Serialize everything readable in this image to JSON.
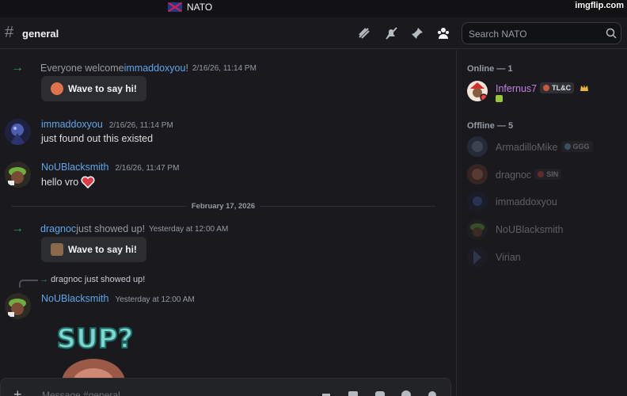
{
  "titlebar": {
    "server_name": "NATO",
    "watermark": "imgflip.com"
  },
  "header": {
    "channel": "general",
    "search_placeholder": "Search NATO"
  },
  "messages": [
    {
      "type": "system",
      "prefix": "Everyone welcome ",
      "user": "immaddoxyou",
      "suffix": "!",
      "time": "2/16/26, 11:14 PM",
      "button": "Wave to say hi!"
    },
    {
      "type": "message",
      "user": "immaddoxyou",
      "time": "2/16/26, 11:14 PM",
      "text": "just found out this existed"
    },
    {
      "type": "message",
      "user": "NoUBlacksmith",
      "time": "2/16/26, 11:47 PM",
      "text": "hello vro"
    },
    {
      "type": "system",
      "user": "dragnoc",
      "suffix": " just showed up!",
      "time": "Yesterday at 12:00 AM",
      "button": "Wave to say hi!"
    },
    {
      "type": "reply",
      "reply_user": "dragnoc",
      "reply_text": " just showed up!",
      "user": "NoUBlacksmith",
      "time": "Yesterday at 12:00 AM",
      "sticker_text": "SUP?"
    }
  ],
  "date_divider": "February 17, 2026",
  "composer": {
    "placeholder": "Message #general"
  },
  "members": {
    "online_header": "Online — 1",
    "offline_header": "Offline — 5",
    "online": [
      {
        "name": "Infernus7",
        "tag": "TL&C",
        "color": "#c67ee8"
      }
    ],
    "offline": [
      {
        "name": "ArmadilloMike",
        "tag": "GGG"
      },
      {
        "name": "dragnoc",
        "tag": "SIN"
      },
      {
        "name": "immaddoxyou",
        "tag": ""
      },
      {
        "name": "NoUBlacksmith",
        "tag": ""
      },
      {
        "name": "Virian",
        "tag": ""
      }
    ]
  },
  "colors": {
    "accent_link": "#5ea6ea",
    "online_green": "#23a55a",
    "background": "#1a1a1e"
  }
}
